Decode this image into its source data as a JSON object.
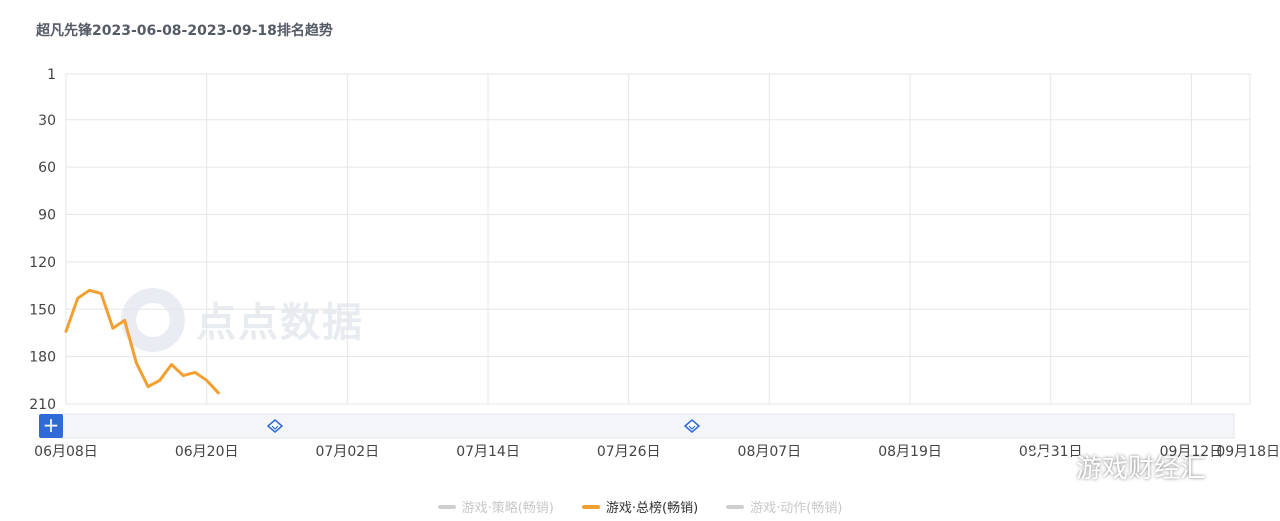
{
  "chart_title": "超凡先锋2023-06-08-2023-09-18排名趋势",
  "watermark": "点点数据",
  "brand_text": "游戏财经汇",
  "colors": {
    "active_series": "#f4a031",
    "inactive_series": "#cfcfcf",
    "grid": "#e6e6e6",
    "zoom_add": "#2f6bd7"
  },
  "chart_data": {
    "type": "line",
    "title": "超凡先锋2023-06-08-2023-09-18排名趋势",
    "y_inverted": true,
    "ylim": [
      1,
      210
    ],
    "yticks": [
      "1",
      "30",
      "60",
      "90",
      "120",
      "150",
      "180",
      "210"
    ],
    "ytick_values": [
      1,
      30,
      60,
      90,
      120,
      150,
      180,
      210
    ],
    "xticks": [
      "06月08日",
      "06月20日",
      "07月02日",
      "07月14日",
      "07月26日",
      "08月07日",
      "08月19日",
      "08月31日",
      "09月12日",
      "09月18日"
    ],
    "xtick_day_offsets": [
      0,
      12,
      24,
      36,
      48,
      60,
      72,
      84,
      96,
      102
    ],
    "xlim_days": 101,
    "grid": true,
    "legend_position": "bottom",
    "series": [
      {
        "name": "游戏·总榜(畅销)",
        "active": true,
        "x": [
          "06-08",
          "06-09",
          "06-10",
          "06-11",
          "06-12",
          "06-13",
          "06-14",
          "06-15",
          "06-16",
          "06-17",
          "06-18",
          "06-19",
          "06-20",
          "06-21"
        ],
        "values": [
          164,
          143,
          138,
          140,
          162,
          157,
          184,
          199,
          195,
          185,
          192,
          190,
          195,
          203
        ]
      },
      {
        "name": "游戏·策略(畅销)",
        "active": false,
        "values": []
      },
      {
        "name": "游戏·动作(畅销)",
        "active": false,
        "values": []
      }
    ]
  },
  "legend": [
    {
      "label": "游戏·策略(畅销)",
      "active": false
    },
    {
      "label": "游戏·总榜(畅销)",
      "active": true
    },
    {
      "label": "游戏·动作(畅销)",
      "active": false
    }
  ],
  "zoom": {
    "add_symbol": "+"
  }
}
